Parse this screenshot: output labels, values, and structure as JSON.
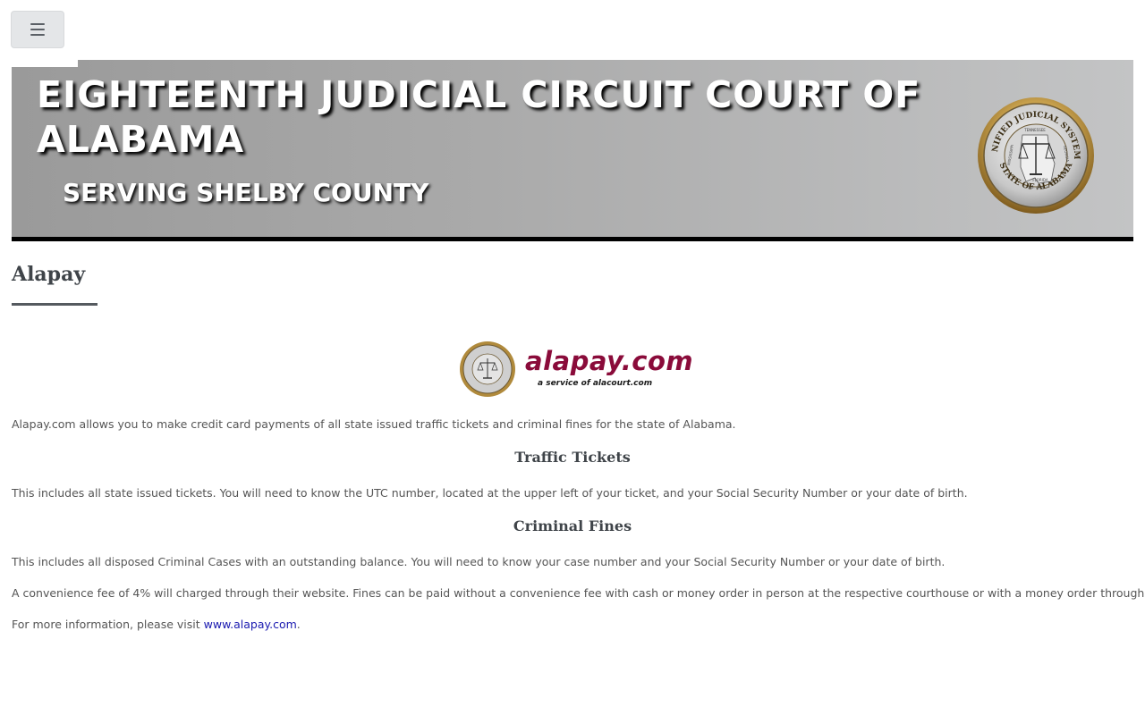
{
  "header": {
    "menu_icon": "hamburger-menu-icon"
  },
  "banner": {
    "title": "EIGHTEENTH JUDICIAL CIRCUIT COURT OF ALABAMA",
    "subtitle": "SERVING SHELBY COUNTY",
    "seal": {
      "top_text": "UNIFIED JUDICIAL SYSTEM",
      "bottom_text": "STATE OF ALABAMA",
      "labels": [
        "MISSISSIPPI",
        "TENNESSEE",
        "GEORGIA",
        "FLORIDA"
      ],
      "year": "A.D. 1973"
    }
  },
  "page": {
    "heading": "Alapay",
    "logo": {
      "name": "alapay.com",
      "tagline": "a service of alacourt.com"
    },
    "intro": "Alapay.com allows you to make credit card payments of all state issued traffic tickets and criminal fines for the state of Alabama.",
    "traffic_heading": "Traffic Tickets",
    "traffic_text": "This includes all state issued tickets. You will need to know the UTC number, located at the upper left of your ticket, and your Social Security Number or your date of birth.",
    "criminal_heading": "Criminal Fines",
    "criminal_text": "This includes all disposed Criminal Cases with an outstanding balance. You will need to know your case number and your Social Security Number or your date of birth.",
    "fee_text": "A convenience fee of 4% will charged through their website. Fines can be paid without a convenience fee with cash or money order in person at the respective courthouse or with a money order through the mail.",
    "more_info_prefix": "For more information, please visit ",
    "more_info_link": "www.alapay.com",
    "more_info_suffix": "."
  },
  "colors": {
    "logo_red": "#8a0b3a",
    "link_blue": "#1a1ab0",
    "banner_border": "#000000"
  }
}
